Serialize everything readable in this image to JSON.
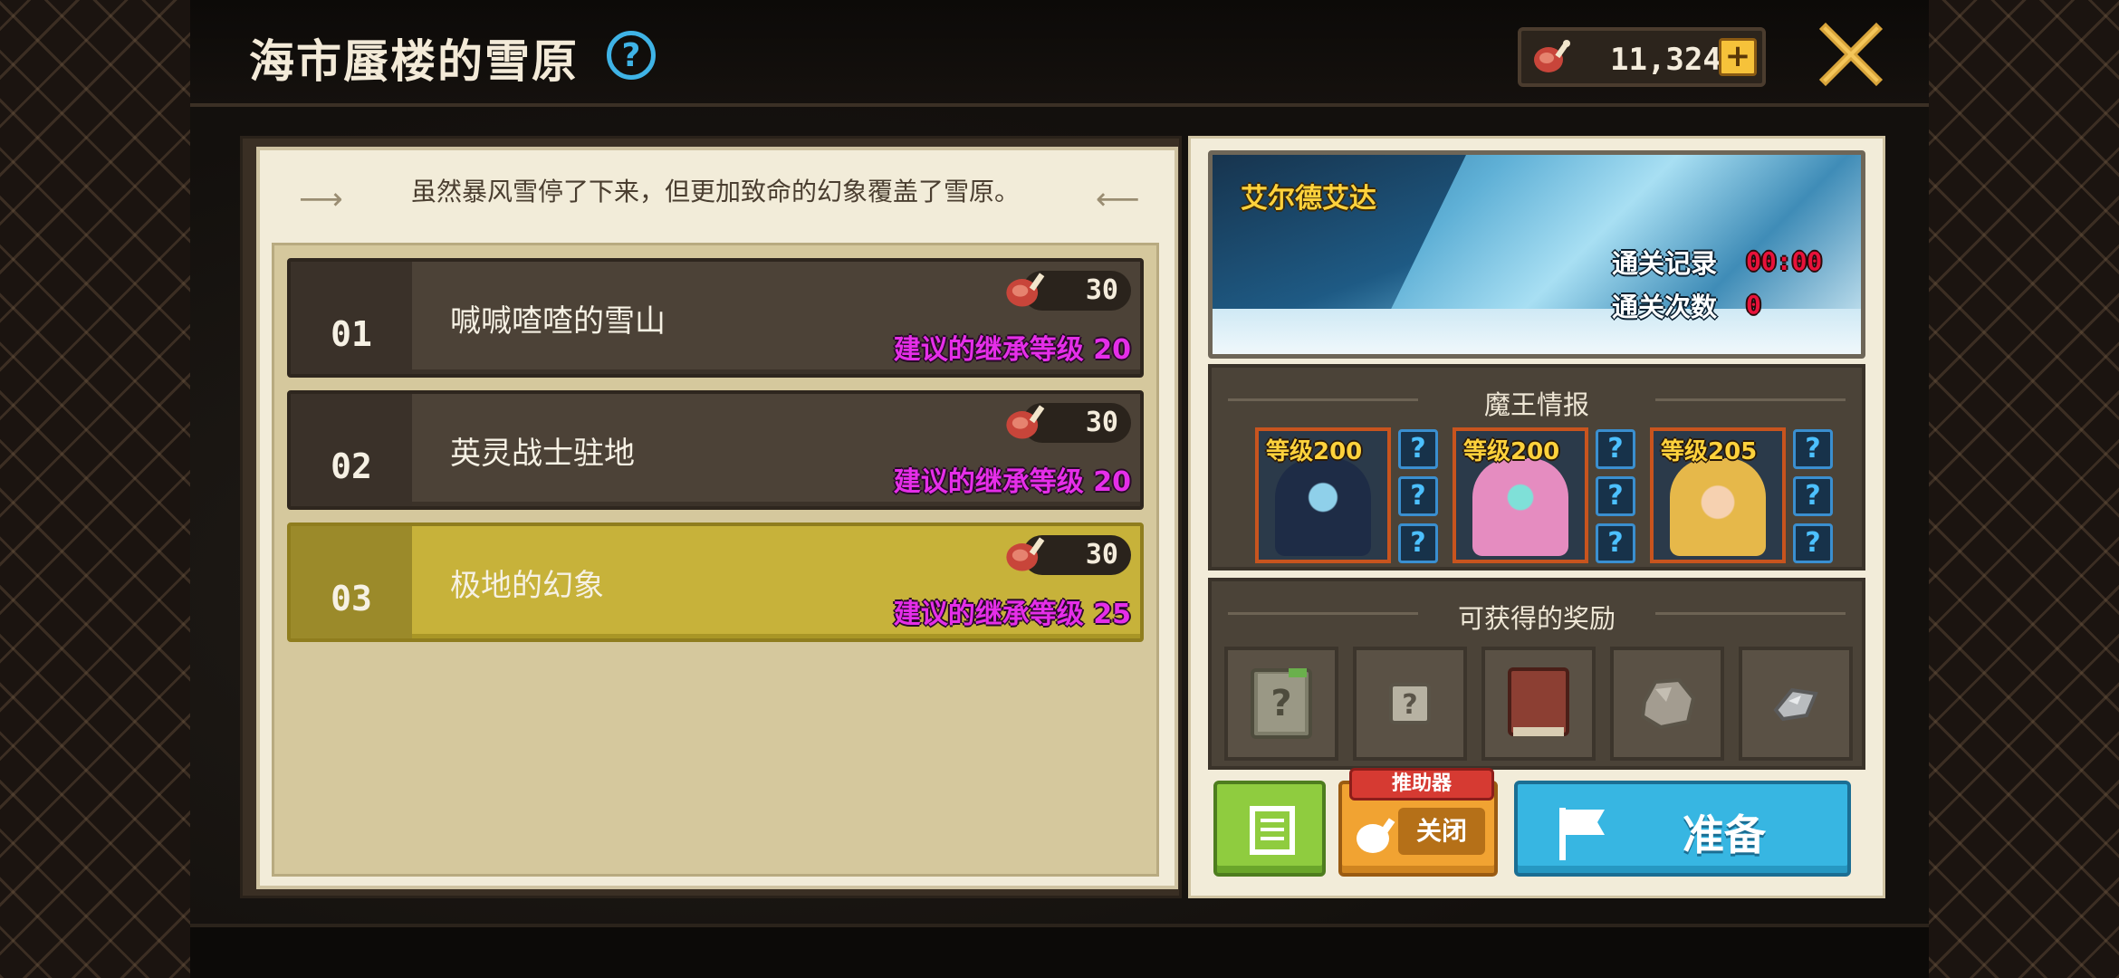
{
  "header": {
    "title": "海市蜃楼的雪原",
    "currency_value": "11,324",
    "plus_label": "+"
  },
  "description": "虽然暴风雪停了下来，但更加致命的幻象覆盖了雪原。",
  "stages": [
    {
      "number": "01",
      "name": "喊喊喳喳的雪山",
      "cost": "30",
      "requirement": "建议的继承等级 20",
      "selected": false
    },
    {
      "number": "02",
      "name": "英灵战士驻地",
      "cost": "30",
      "requirement": "建议的继承等级 20",
      "selected": false
    },
    {
      "number": "03",
      "name": "极地的幻象",
      "cost": "30",
      "requirement": "建议的继承等级 25",
      "selected": true
    }
  ],
  "area": {
    "name": "艾尔德艾达",
    "record_label": "通关记录",
    "record_value": "00:00",
    "count_label": "通关次数",
    "count_value": "0"
  },
  "boss_section": {
    "title": "魔王情报",
    "bosses": [
      {
        "level": "等级200",
        "portrait": "dark-blue-haired-boss"
      },
      {
        "level": "等级200",
        "portrait": "pink-haired-boss"
      },
      {
        "level": "等级205",
        "portrait": "blonde-haired-boss"
      }
    ],
    "skill_placeholder": "?"
  },
  "reward_section": {
    "title": "可获得的奖励",
    "items": [
      "mystery-book-icon",
      "mystery-box-icon",
      "leather-tome-icon",
      "stone-ore-icon",
      "metal-shard-icon"
    ]
  },
  "buttons": {
    "helper_tag": "推助器",
    "helper_state": "关闭",
    "ready": "准备"
  },
  "colors": {
    "stage_selected": "#c7b23a",
    "stage_normal": "#4c4237",
    "requirement_text": "#e52ee8",
    "ready_button": "#37b6e2",
    "helper_button": "#f1a332",
    "list_button": "#8fcc3f"
  }
}
